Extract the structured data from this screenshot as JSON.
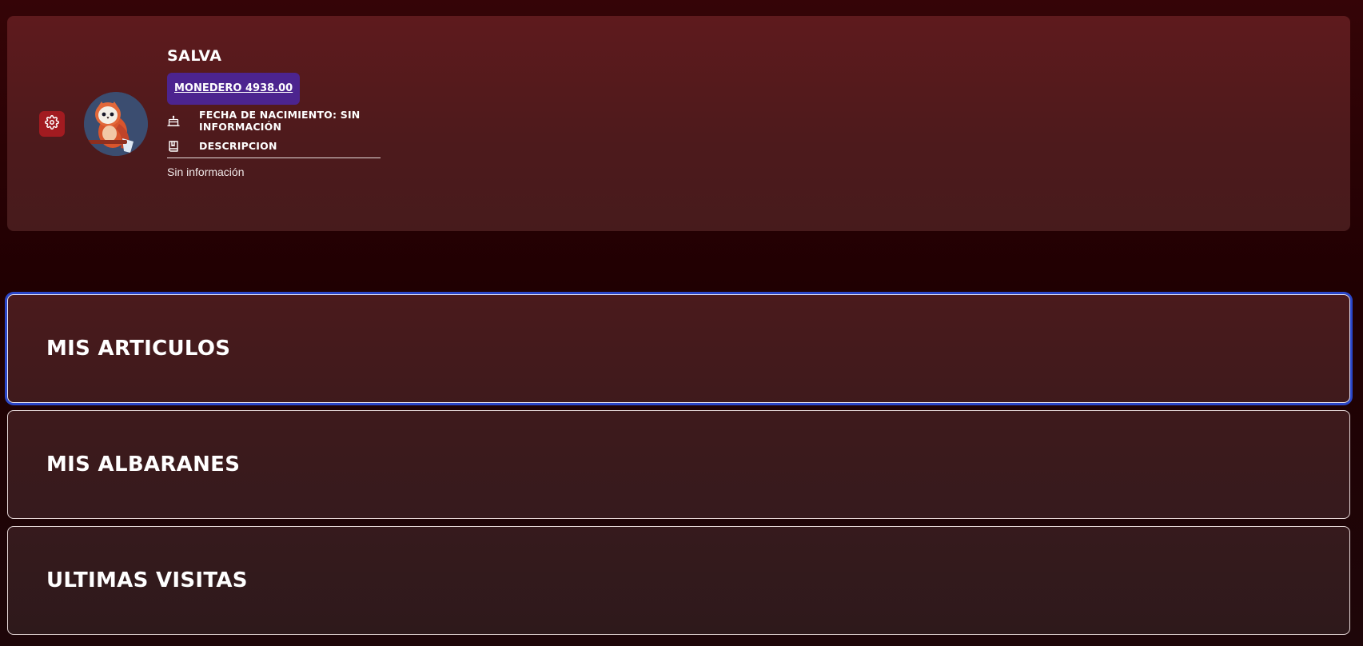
{
  "profile": {
    "username": "SALVA",
    "wallet_label": "MONEDERO 4938.00",
    "birthdate_label": "FECHA DE NACIMIENTO: SIN INFORMACIÓN",
    "description_label": "DESCRIPCION",
    "description_value": "Sin información",
    "settings_icon": "gear-icon",
    "birthdate_icon": "cake-icon",
    "description_icon": "book-icon",
    "avatar_image": "owl-avatar"
  },
  "sections": {
    "articulos": "MIS ARTICULOS",
    "albaranes": "MIS ALBARANES",
    "visitas": "ULTIMAS VISITAS"
  },
  "colors": {
    "background": "#200002",
    "card": "#5e1a1d",
    "settings_button": "#a21b20",
    "wallet_button": "#4c248f",
    "focus_ring": "#2a46c8",
    "text": "#ffffff"
  }
}
